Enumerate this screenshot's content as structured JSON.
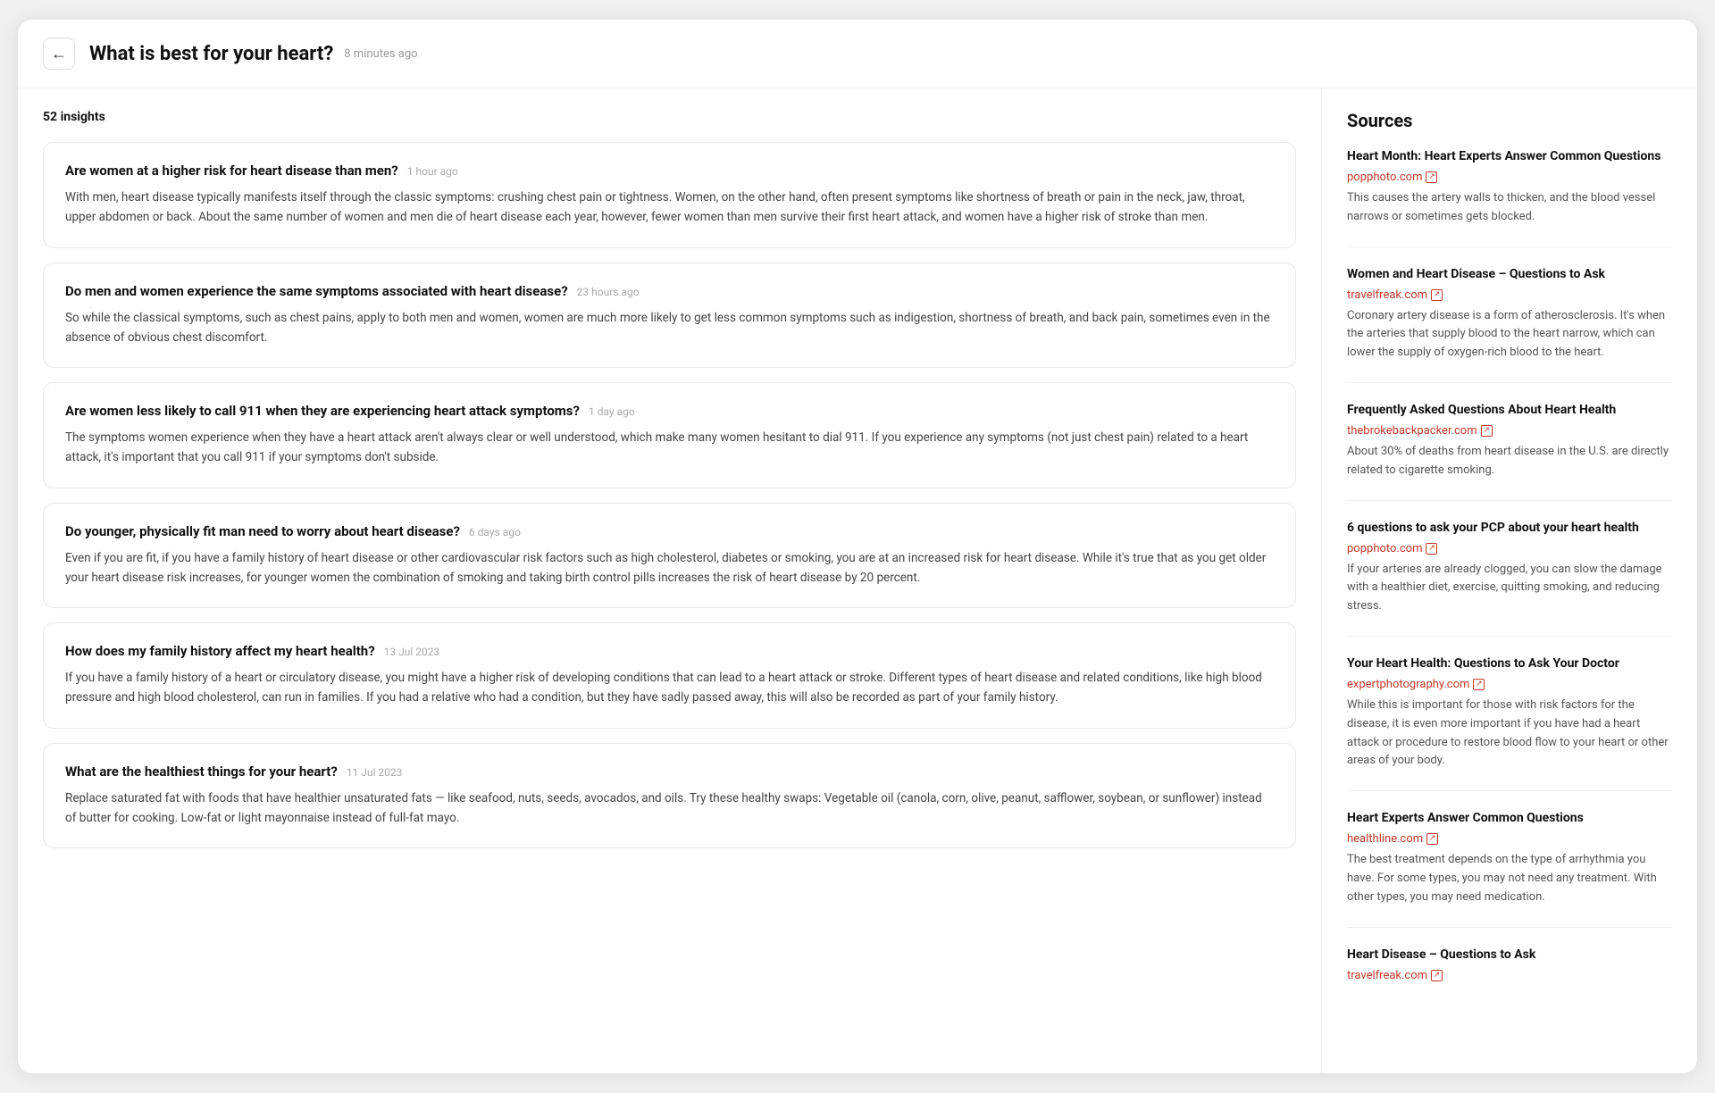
{
  "header": {
    "back_label": "←",
    "title": "What is best for your heart?",
    "time": "8 minutes ago"
  },
  "insights": {
    "count": "52",
    "count_label": "insights",
    "items": [
      {
        "title": "Are women at a higher risk for heart disease than men?",
        "time": "1 hour ago",
        "body": "With men, heart disease typically manifests itself through the classic symptoms: crushing chest pain or tightness. Women, on the other hand, often present symptoms like shortness of breath or pain in the neck, jaw, throat, upper abdomen or back. About the same number of women and men die of heart disease each year, however, fewer women than men survive their first heart attack, and women have a higher risk of stroke than men."
      },
      {
        "title": "Do men and women experience the same symptoms associated with heart disease?",
        "time": "23 hours ago",
        "body": "So while the classical symptoms, such as chest pains, apply to both men and women, women are much more likely to get less common symptoms such as indigestion, shortness of breath, and back pain, sometimes even in the absence of obvious chest discomfort."
      },
      {
        "title": "Are women less likely to call 911 when they are experiencing heart attack symptoms?",
        "time": "1 day ago",
        "body": "The symptoms women experience when they have a heart attack aren't always clear or well understood, which make many women hesitant to dial 911. If you experience any symptoms (not just chest pain) related to a heart attack, it's important that you call 911 if your symptoms don't subside."
      },
      {
        "title": "Do younger, physically fit man  need to worry about heart disease?",
        "time": "6 days ago",
        "body": "Even if you are fit, if you have a family history of heart disease or other cardiovascular risk factors such as high cholesterol, diabetes or smoking, you are at an increased risk for heart disease. While it's true that as you get older your heart disease risk increases, for younger women the combination of smoking and taking birth control pills increases the risk of heart disease by 20 percent."
      },
      {
        "title": "How does my family history affect my heart health?",
        "time": "13 Jul 2023",
        "body": "If you have a family history of a heart or circulatory disease, you might have a higher risk of developing conditions that can lead to a heart attack or stroke. Different types of heart disease and related conditions, like high blood pressure and high blood cholesterol, can run in families. If you had a relative who had a condition, but they have sadly passed away, this will also be recorded as part of your family history."
      },
      {
        "title": "What are the healthiest things for your heart?",
        "time": "11 Jul 2023",
        "body": "Replace saturated fat with foods that have healthier unsaturated fats — like seafood, nuts, seeds, avocados, and oils. Try these healthy swaps: Vegetable oil (canola, corn, olive, peanut, safflower, soybean, or sunflower) instead of butter for cooking. Low-fat or light mayonnaise instead of full-fat mayo."
      }
    ]
  },
  "sources": {
    "title": "Sources",
    "items": [
      {
        "name": "Heart Month: Heart Experts Answer Common Questions",
        "url": "popphoto.com",
        "excerpt": "This causes the artery walls to thicken, and the blood vessel narrows or sometimes gets blocked."
      },
      {
        "name": "Women and Heart Disease – Questions to Ask",
        "url": "travelfreak.com",
        "excerpt": "Coronary artery disease is a form of atherosclerosis. It's when the arteries that supply blood to the heart narrow, which can lower the supply of oxygen-rich blood to the heart."
      },
      {
        "name": "Frequently Asked Questions About Heart Health",
        "url": "thebrokebackpacker.com",
        "excerpt": "About 30% of deaths from heart disease in the U.S. are directly related to cigarette smoking."
      },
      {
        "name": "6 questions to ask your PCP about your heart health",
        "url": "popphoto.com",
        "excerpt": "If your arteries are already clogged, you can slow the damage with a healthier diet, exercise, quitting smoking, and reducing stress."
      },
      {
        "name": "Your Heart Health: Questions to Ask Your Doctor",
        "url": "expertphotography.com",
        "excerpt": "While this is important for those with risk factors for the disease, it is even more important if you have had a heart attack or procedure to restore blood flow to your heart or other areas of your body."
      },
      {
        "name": "Heart Experts Answer Common Questions",
        "url": "healthline.com",
        "excerpt": "The best treatment depends on the type of arrhythmia you have. For some types, you may not need any treatment. With other types, you may need medication."
      },
      {
        "name": "Heart Disease – Questions to Ask",
        "url": "travelfreak.com",
        "excerpt": ""
      }
    ]
  }
}
